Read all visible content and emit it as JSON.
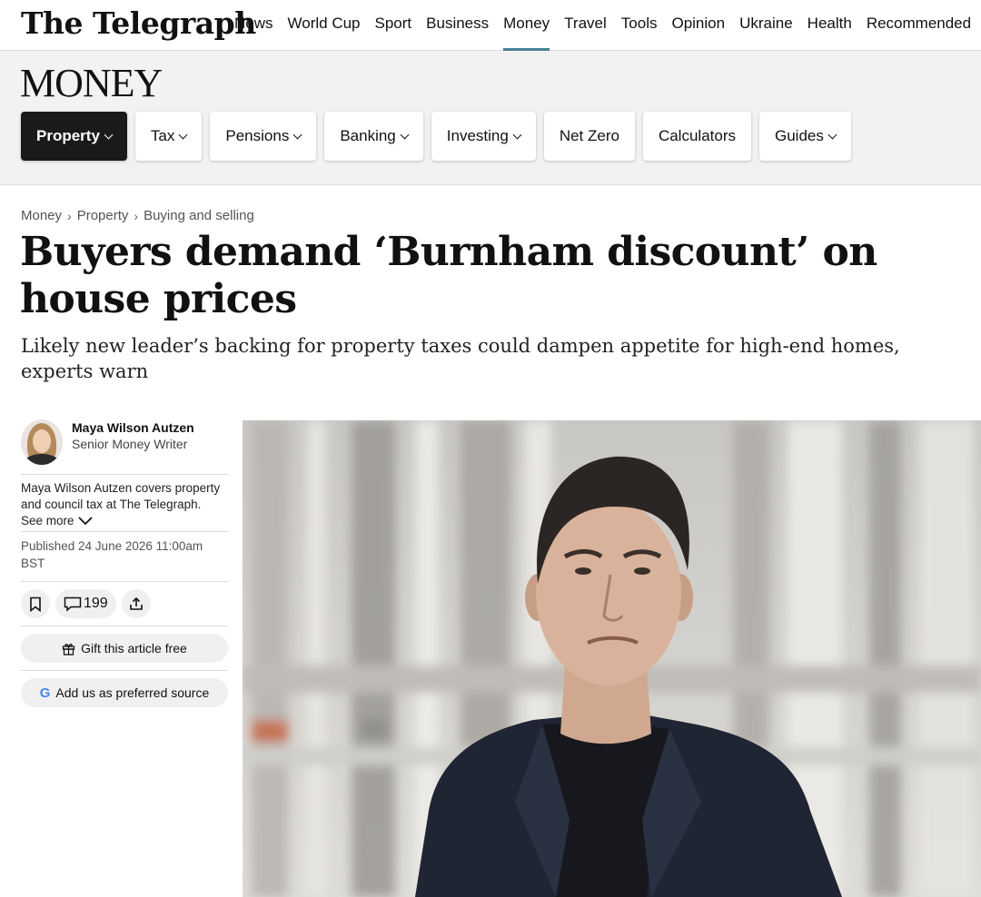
{
  "logo": "The Telegraph",
  "nav": [
    {
      "label": "News",
      "active": false
    },
    {
      "label": "World Cup",
      "active": false
    },
    {
      "label": "Sport",
      "active": false
    },
    {
      "label": "Business",
      "active": false
    },
    {
      "label": "Money",
      "active": true
    },
    {
      "label": "Travel",
      "active": false
    },
    {
      "label": "Tools",
      "active": false
    },
    {
      "label": "Opinion",
      "active": false
    },
    {
      "label": "Ukraine",
      "active": false
    },
    {
      "label": "Health",
      "active": false
    },
    {
      "label": "Recommended",
      "active": false
    }
  ],
  "section": {
    "title": "MONEY",
    "subnav": [
      {
        "label": "Property",
        "dropdown": true,
        "active": true
      },
      {
        "label": "Tax",
        "dropdown": true,
        "active": false
      },
      {
        "label": "Pensions",
        "dropdown": true,
        "active": false
      },
      {
        "label": "Banking",
        "dropdown": true,
        "active": false
      },
      {
        "label": "Investing",
        "dropdown": true,
        "active": false
      },
      {
        "label": "Net Zero",
        "dropdown": false,
        "active": false
      },
      {
        "label": "Calculators",
        "dropdown": false,
        "active": false
      },
      {
        "label": "Guides",
        "dropdown": true,
        "active": false
      }
    ]
  },
  "breadcrumb": [
    "Money",
    "Property",
    "Buying and selling"
  ],
  "article": {
    "headline": "Buyers demand ‘Burnham discount’ on house prices",
    "standfirst": "Likely new leader’s backing for property taxes could dampen appetite for high-end homes, experts warn"
  },
  "author": {
    "name": "Maya Wilson Autzen",
    "role": "Senior Money Writer",
    "bio": "Maya Wilson Autzen covers property and council tax at The Telegraph.",
    "see_more": "See more"
  },
  "published": "Published 24 June 2026 11:00am BST",
  "comments_count": "199",
  "gift_label": "Gift this article free",
  "preferred_source_label": "Add us as preferred source",
  "google_glyph": "G",
  "colors": {
    "nav_active_underline": "#4a7f97",
    "section_bg": "#f2f2f2",
    "active_pill_bg": "#1a1a1a"
  }
}
